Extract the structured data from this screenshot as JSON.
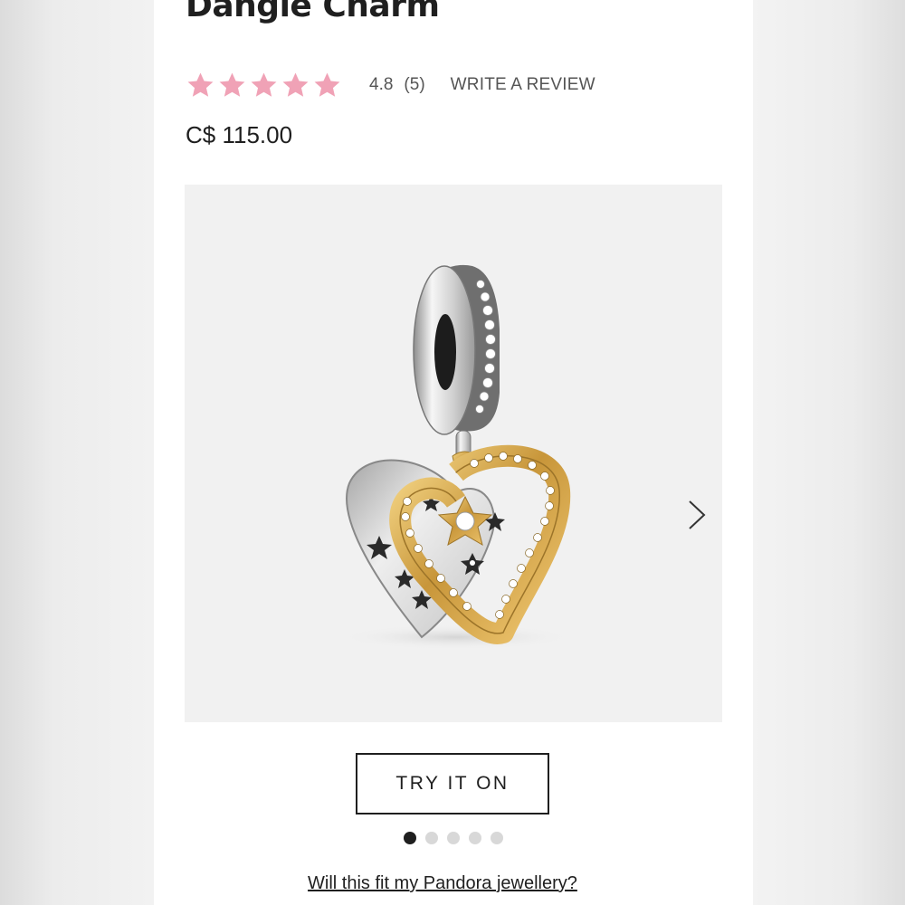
{
  "product": {
    "title": "Dangle Charm",
    "rating": {
      "stars_filled": 5,
      "stars_total": 5,
      "value": "4.8",
      "count": "(5)",
      "write_review_label": "WRITE A REVIEW",
      "star_color": "#f0a2b6"
    },
    "price": "C$ 115.00"
  },
  "gallery": {
    "image_icon": "heart-dangle-charm-image",
    "next_icon": "chevron-right-icon",
    "current_index": 1,
    "total_images": 5
  },
  "actions": {
    "try_on_label": "TRY IT ON",
    "fit_link_label": "Will this fit my Pandora jewellery?"
  }
}
